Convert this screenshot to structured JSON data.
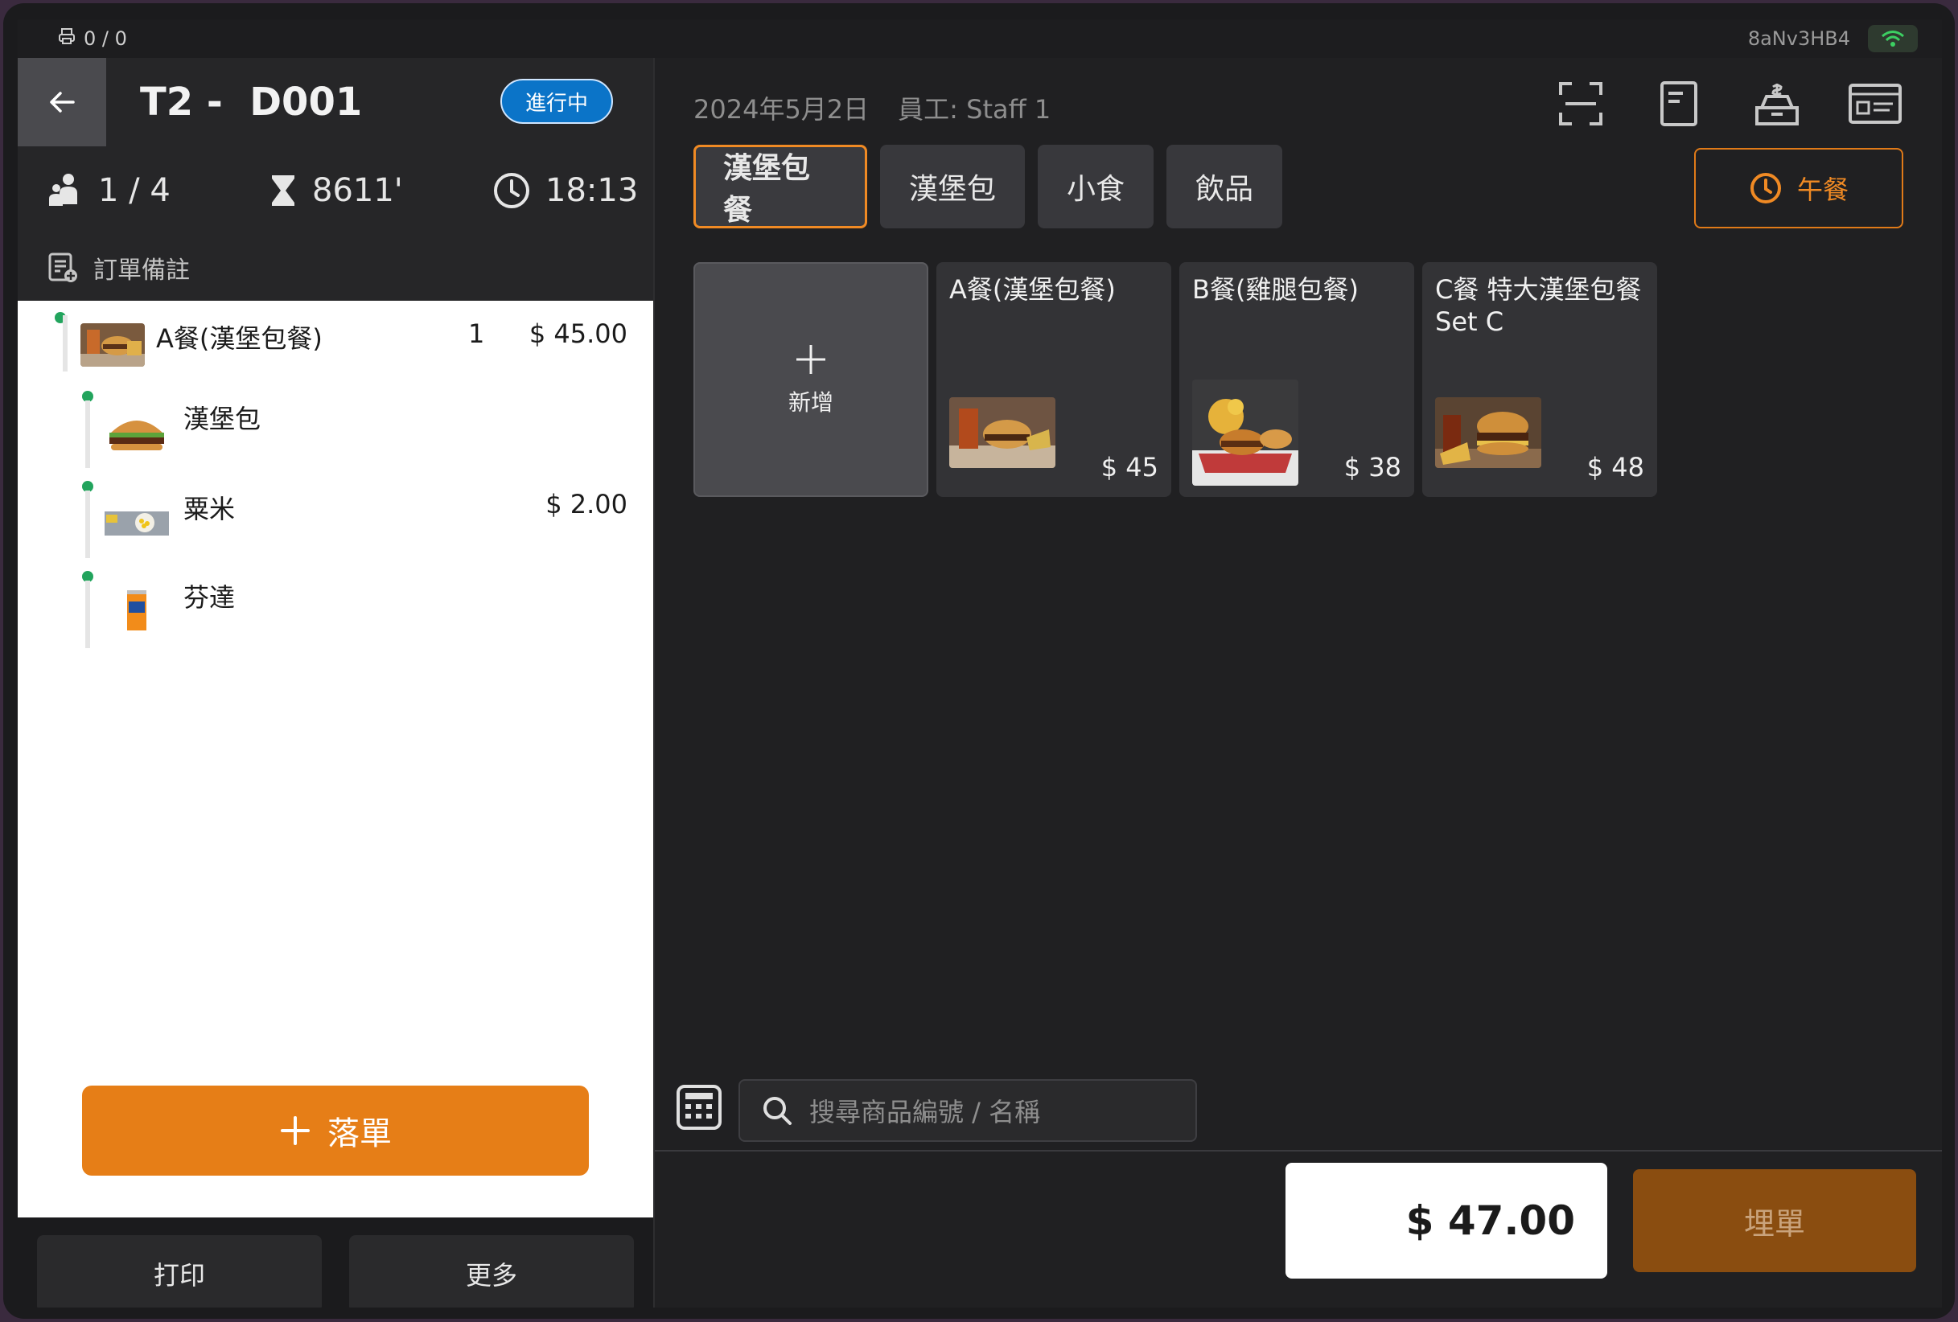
{
  "status_bar": {
    "printer_count": "0 / 0",
    "device_id": "8aNv3HB4",
    "wifi_color": "#3ccf62"
  },
  "order": {
    "table_title": "T2 -  D001",
    "status": "進行中",
    "guests": "1 / 4",
    "duration": "8611'",
    "time": "18:13",
    "note_label": "訂單備註"
  },
  "order_items": [
    {
      "name": "A餐(漢堡包餐)",
      "qty": "1",
      "price": "$ 45.00",
      "image": "combo-meal",
      "status": "active"
    },
    {
      "name": "漢堡包",
      "qty": "",
      "price": "",
      "image": "burger",
      "status": "active"
    },
    {
      "name": "粟米",
      "qty": "",
      "price": "$ 2.00",
      "image": "corn",
      "status": "active"
    },
    {
      "name": "芬達",
      "qty": "",
      "price": "",
      "image": "fanta-can",
      "status": "active"
    }
  ],
  "actions": {
    "submit": "落單",
    "print": "打印",
    "more": "更多"
  },
  "header": {
    "date": "2024年5月2日",
    "staff": "員工: Staff 1"
  },
  "top_icons": [
    "scan-icon",
    "receipt-icon",
    "cash-register-icon",
    "id-card-icon"
  ],
  "tabs": [
    {
      "label": "漢堡包餐",
      "active": true
    },
    {
      "label": "漢堡包",
      "active": false
    },
    {
      "label": "小食",
      "active": false
    },
    {
      "label": "飲品",
      "active": false
    }
  ],
  "meal_period": "午餐",
  "add_tile_label": "新增",
  "products": [
    {
      "name": "A餐(漢堡包餐)",
      "price": "$ 45",
      "image": "burger-meal-photo"
    },
    {
      "name": "B餐(雞腿包餐)",
      "price": "$ 38",
      "image": "chicken-burger-photo"
    },
    {
      "name": "C餐 特大漢堡包餐 Set C",
      "price": "$ 48",
      "image": "big-burger-photo"
    }
  ],
  "search": {
    "placeholder": "搜尋商品編號 / 名稱"
  },
  "summary": {
    "total": "$ 47.00",
    "settle": "埋單"
  },
  "colors": {
    "accent": "#e67e17",
    "status_blue": "#0b74c8",
    "dot_green": "#22a45d"
  }
}
